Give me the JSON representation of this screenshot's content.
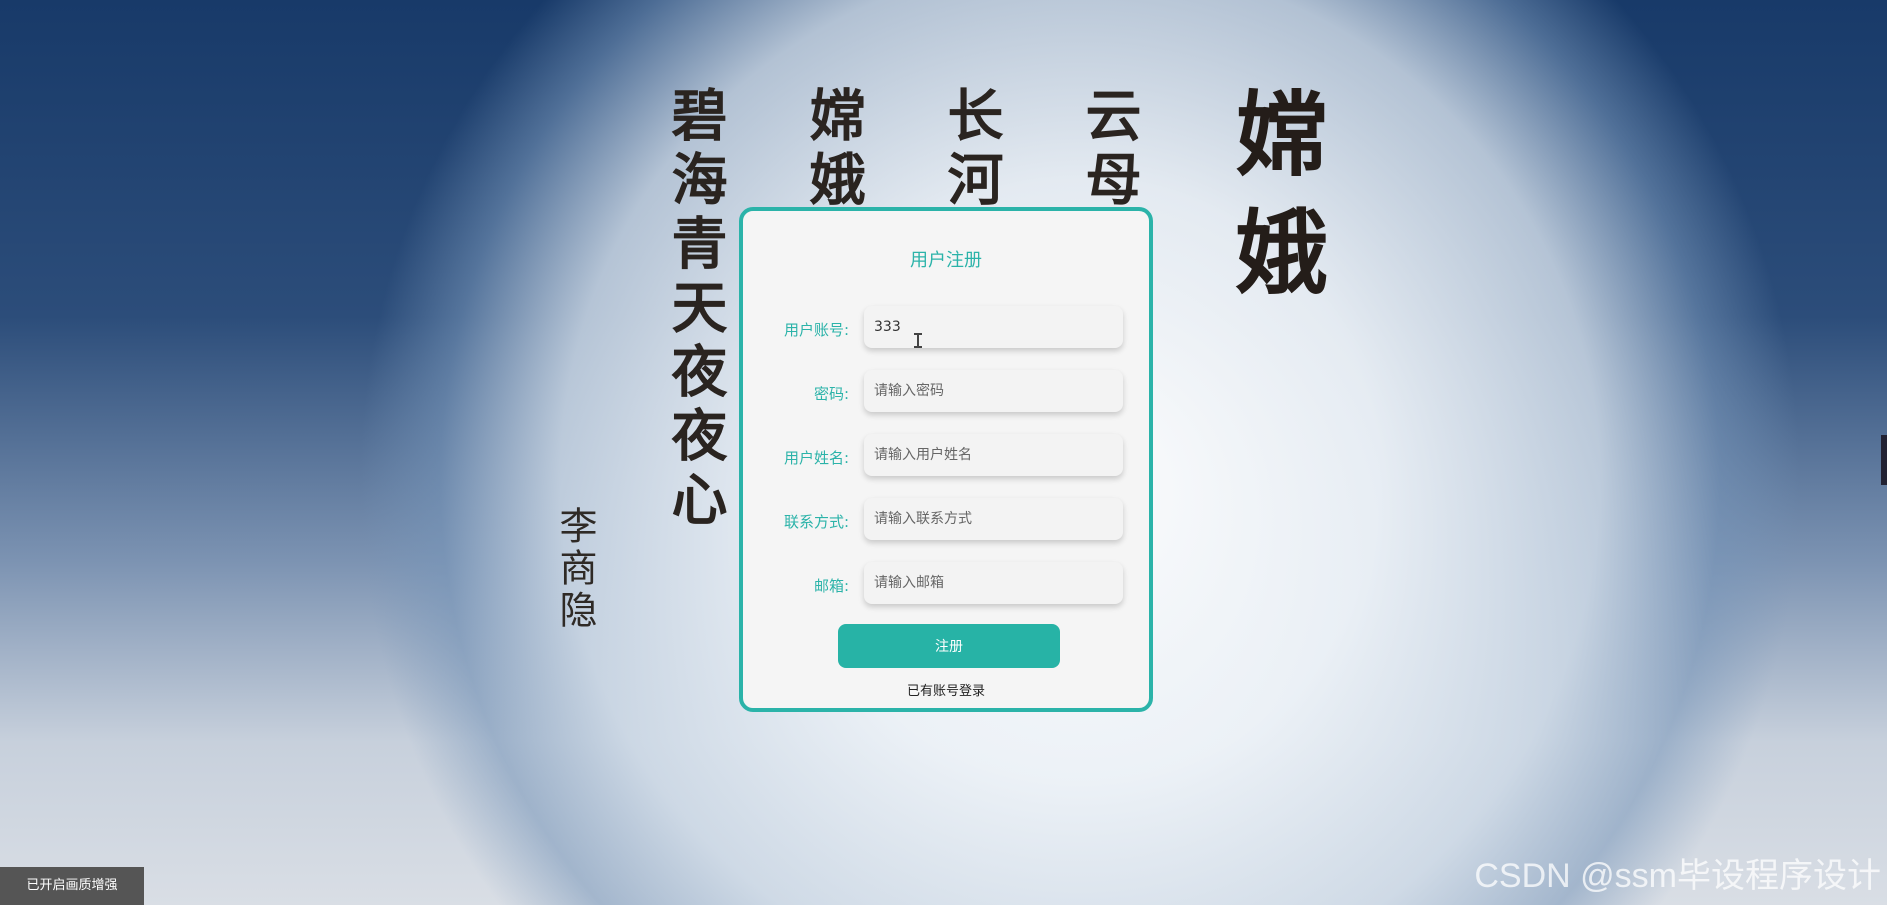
{
  "poem": {
    "title": "嫦娥",
    "author": "李商隐",
    "lines": [
      "碧海青天夜夜心",
      "嫦娥应悔偷灵药",
      "长河渐落晓星沉",
      "云母屏风烛影深"
    ]
  },
  "form": {
    "title": "用户注册",
    "fields": [
      {
        "label": "用户账号:",
        "value": "333",
        "placeholder": ""
      },
      {
        "label": "密码:",
        "value": "",
        "placeholder": "请输入密码"
      },
      {
        "label": "用户姓名:",
        "value": "",
        "placeholder": "请输入用户姓名"
      },
      {
        "label": "联系方式:",
        "value": "",
        "placeholder": "请输入联系方式"
      },
      {
        "label": "邮箱:",
        "value": "",
        "placeholder": "请输入邮箱"
      }
    ],
    "submit_label": "注册",
    "login_link": "已有账号登录"
  },
  "overlay": {
    "quality_badge": "已开启画质增强",
    "watermark": "CSDN @ssm毕设程序设计"
  },
  "colors": {
    "accent": "#2bb3a9"
  }
}
